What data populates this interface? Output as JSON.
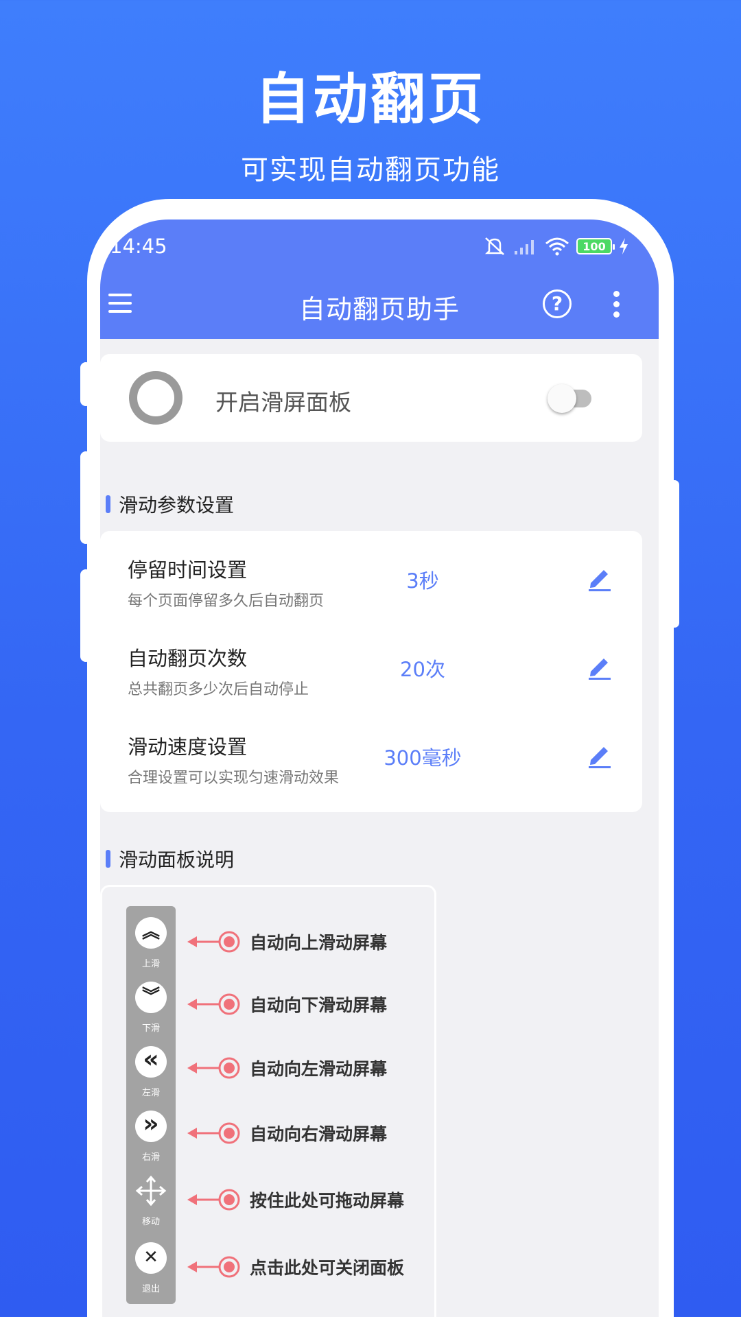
{
  "promo": {
    "title": "自动翻页",
    "subtitle": "可实现自动翻页功能"
  },
  "status_bar": {
    "time": "14:45",
    "battery": "100",
    "icons": [
      "mute-icon",
      "signal-icon",
      "wifi-icon",
      "battery-icon",
      "charging-icon"
    ]
  },
  "app_bar": {
    "title": "自动翻页助手",
    "help_label": "?",
    "icons": [
      "menu-icon",
      "help-icon",
      "more-icon"
    ]
  },
  "panel_toggle": {
    "label": "开启滑屏面板",
    "enabled": false
  },
  "slide_settings": {
    "section_title": "滑动参数设置",
    "items": [
      {
        "title": "停留时间设置",
        "desc": "每个页面停留多久后自动翻页",
        "value": "3秒"
      },
      {
        "title": "自动翻页次数",
        "desc": "总共翻页多少次后自动停止",
        "value": "20次"
      },
      {
        "title": "滑动速度设置",
        "desc": "合理设置可以实现匀速滑动效果",
        "value": "300毫秒"
      }
    ]
  },
  "panel_explain": {
    "section_title": "滑动面板说明",
    "controls": [
      {
        "glyph": "︽",
        "label": "上滑",
        "desc": "自动向上滑动屏幕"
      },
      {
        "glyph": "︾",
        "label": "下滑",
        "desc": "自动向下滑动屏幕"
      },
      {
        "glyph": "«",
        "label": "左滑",
        "desc": "自动向左滑动屏幕"
      },
      {
        "glyph": "»",
        "label": "右滑",
        "desc": "自动向右滑动屏幕"
      },
      {
        "glyph": "",
        "label": "移动",
        "desc": "按住此处可拖动屏幕"
      },
      {
        "glyph": "✕",
        "label": "退出",
        "desc": "点击此处可关闭面板"
      }
    ]
  },
  "colors": {
    "accent": "#5b7ef8",
    "pointer": "#f0717a",
    "background_top": "#3f7efc",
    "background_bottom": "#2f5cf1"
  }
}
